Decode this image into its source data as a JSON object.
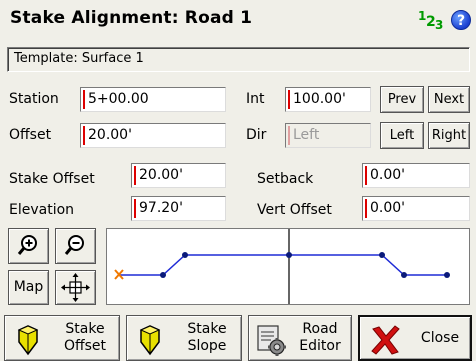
{
  "window": {
    "title": "Stake Alignment: Road 1",
    "num_icon": [
      "1",
      "2",
      "3"
    ],
    "help": "?"
  },
  "template": {
    "label": "Template: Surface 1"
  },
  "station": {
    "label": "Station",
    "value": "5+00.00"
  },
  "interval": {
    "label": "Int",
    "value": "100.00'"
  },
  "prev_label": "Prev",
  "next_label": "Next",
  "offset": {
    "label": "Offset",
    "value": "20.00'"
  },
  "direction": {
    "label": "Dir",
    "value": "Left"
  },
  "left_label": "Left",
  "right_label": "Right",
  "stake_offset": {
    "label": "Stake Offset",
    "value": "20.00'"
  },
  "setback": {
    "label": "Setback",
    "value": "0.00'"
  },
  "elevation": {
    "label": "Elevation",
    "value": "97.20'"
  },
  "vert_offset": {
    "label": "Vert Offset",
    "value": "0.00'"
  },
  "map_label": "Map",
  "bottom": {
    "stake_offset": {
      "line1": "Stake",
      "line2": "Offset"
    },
    "stake_slope": {
      "line1": "Stake",
      "line2": "Slope"
    },
    "road_editor": {
      "line1": "Road",
      "line2": "Editor"
    },
    "close": "Close"
  },
  "colors": {
    "profile_line": "#1f2bd6",
    "marker": "#f07800",
    "field_marker": "#d00000"
  }
}
